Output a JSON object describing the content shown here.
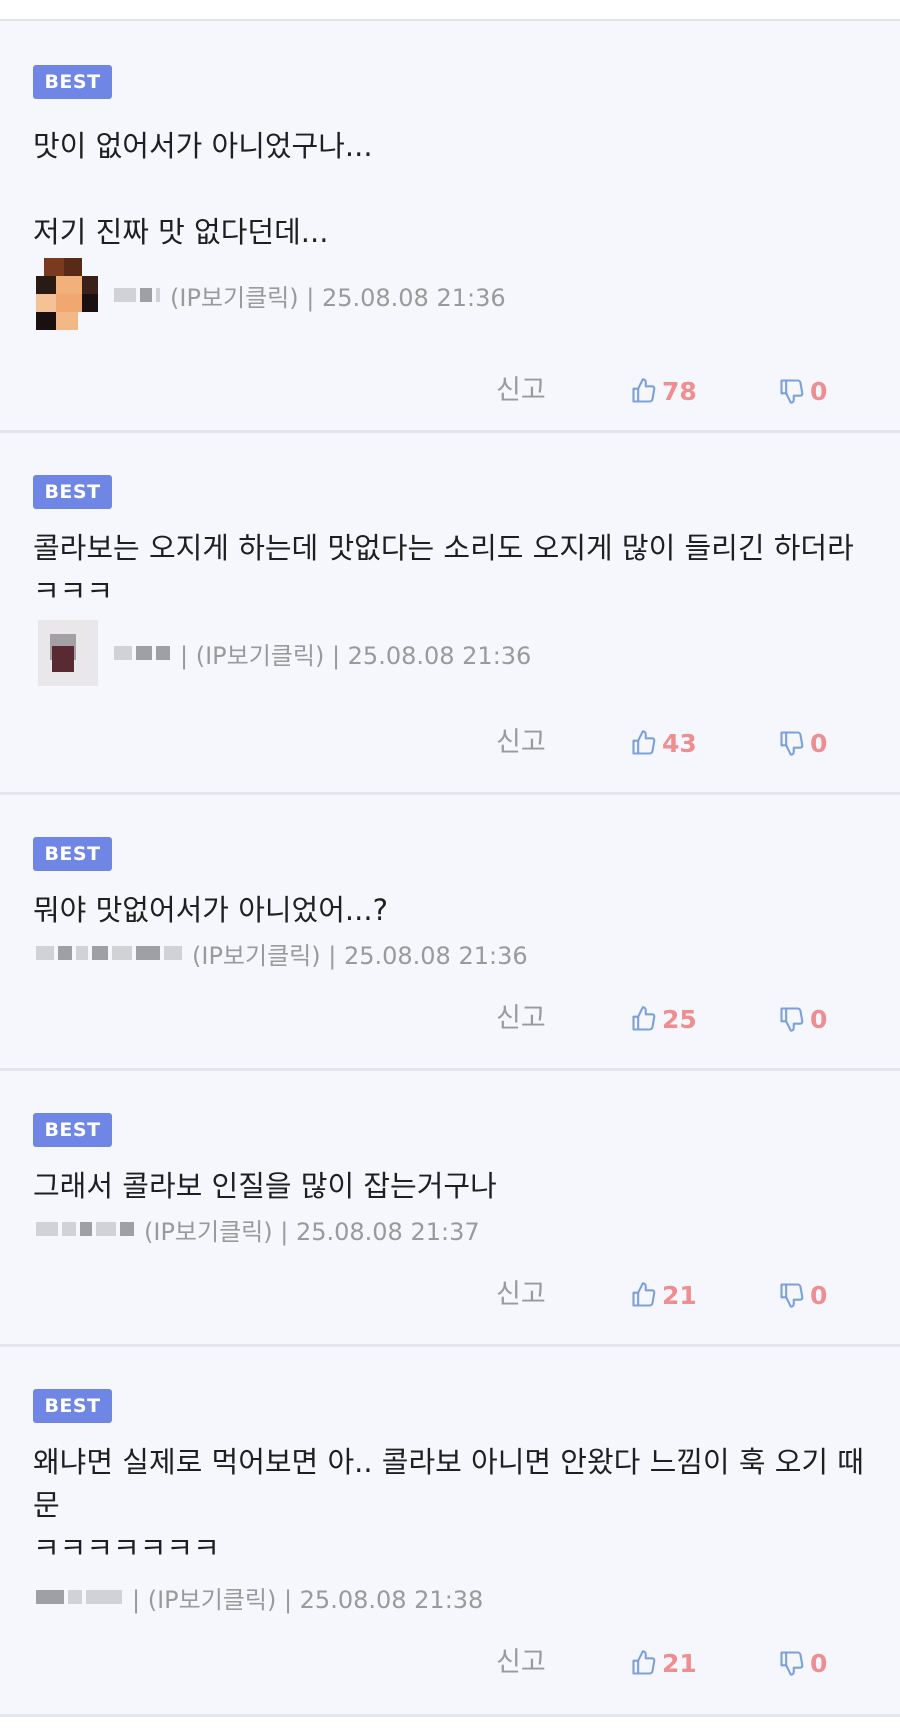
{
  "badge_label": "BEST",
  "report_label": "신고",
  "colors": {
    "badge_bg": "#6f86e4",
    "vote_count": "#ef8e90",
    "thumb_icon": "#7aa1d9",
    "meta_text": "#9a9a9a",
    "panel_bg": "#f5f7fc"
  },
  "comments": [
    {
      "text": "맛이 없어서가 아니었구나...\n\n저기 진짜 맛 없다던데...",
      "meta": "(IP보기클릭) | 25.08.08 21:36",
      "likes": "78",
      "dislikes": "0"
    },
    {
      "text": "콜라보는 오지게 하는데 맛없다는 소리도 오지게 많이 들리긴 하더라ㅋㅋㅋ",
      "meta": "| (IP보기클릭) | 25.08.08 21:36",
      "likes": "43",
      "dislikes": "0"
    },
    {
      "text": "뭐야 맛없어서가 아니었어...?",
      "meta": "(IP보기클릭) | 25.08.08 21:36",
      "likes": "25",
      "dislikes": "0"
    },
    {
      "text": "그래서 콜라보 인질을 많이 잡는거구나",
      "meta": "(IP보기클릭) | 25.08.08 21:37",
      "likes": "21",
      "dislikes": "0"
    },
    {
      "text": "왜냐면 실제로 먹어보면 아.. 콜라보 아니면 안왔다 느낌이 훅 오기 때문\nㅋㅋㅋㅋㅋㅋㅋ",
      "meta": "| (IP보기클릭) | 25.08.08 21:38",
      "likes": "21",
      "dislikes": "0"
    }
  ]
}
